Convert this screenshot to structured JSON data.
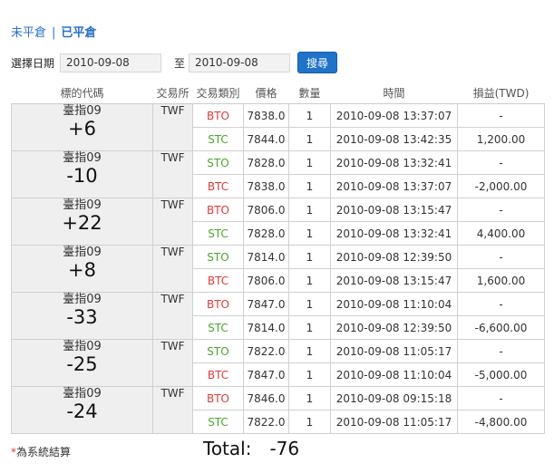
{
  "tabs": {
    "open_label": "未平倉",
    "closed_label": "已平倉"
  },
  "datebar": {
    "label": "選擇日期",
    "from": "2010-09-08",
    "to_label": "至",
    "to": "2010-09-08",
    "search_label": "搜尋"
  },
  "columns": [
    "標的代碼",
    "交易所",
    "交易類別",
    "價格",
    "數量",
    "時間",
    "損益(TWD)"
  ],
  "groups": [
    {
      "symbol": "臺指09",
      "points": "+6",
      "exchange": "TWF",
      "rows": [
        {
          "type": "BTO",
          "price": "7838.0",
          "qty": "1",
          "time": "2010-09-08 13:37:07",
          "pl": "-"
        },
        {
          "type": "STC",
          "price": "7844.0",
          "qty": "1",
          "time": "2010-09-08 13:42:35",
          "pl": "1,200.00"
        }
      ]
    },
    {
      "symbol": "臺指09",
      "points": "-10",
      "exchange": "TWF",
      "rows": [
        {
          "type": "STO",
          "price": "7828.0",
          "qty": "1",
          "time": "2010-09-08 13:32:41",
          "pl": "-"
        },
        {
          "type": "BTC",
          "price": "7838.0",
          "qty": "1",
          "time": "2010-09-08 13:37:07",
          "pl": "-2,000.00"
        }
      ]
    },
    {
      "symbol": "臺指09",
      "points": "+22",
      "exchange": "TWF",
      "rows": [
        {
          "type": "BTO",
          "price": "7806.0",
          "qty": "1",
          "time": "2010-09-08 13:15:47",
          "pl": "-"
        },
        {
          "type": "STC",
          "price": "7828.0",
          "qty": "1",
          "time": "2010-09-08 13:32:41",
          "pl": "4,400.00"
        }
      ]
    },
    {
      "symbol": "臺指09",
      "points": "+8",
      "exchange": "TWF",
      "rows": [
        {
          "type": "STO",
          "price": "7814.0",
          "qty": "1",
          "time": "2010-09-08 12:39:50",
          "pl": "-"
        },
        {
          "type": "BTC",
          "price": "7806.0",
          "qty": "1",
          "time": "2010-09-08 13:15:47",
          "pl": "1,600.00"
        }
      ]
    },
    {
      "symbol": "臺指09",
      "points": "-33",
      "exchange": "TWF",
      "rows": [
        {
          "type": "BTO",
          "price": "7847.0",
          "qty": "1",
          "time": "2010-09-08 11:10:04",
          "pl": "-"
        },
        {
          "type": "STC",
          "price": "7814.0",
          "qty": "1",
          "time": "2010-09-08 12:39:50",
          "pl": "-6,600.00"
        }
      ]
    },
    {
      "symbol": "臺指09",
      "points": "-25",
      "exchange": "TWF",
      "rows": [
        {
          "type": "STO",
          "price": "7822.0",
          "qty": "1",
          "time": "2010-09-08 11:05:17",
          "pl": "-"
        },
        {
          "type": "BTC",
          "price": "7847.0",
          "qty": "1",
          "time": "2010-09-08 11:10:04",
          "pl": "-5,000.00"
        }
      ]
    },
    {
      "symbol": "臺指09",
      "points": "-24",
      "exchange": "TWF",
      "rows": [
        {
          "type": "BTO",
          "price": "7846.0",
          "qty": "1",
          "time": "2010-09-08 09:15:18",
          "pl": "-"
        },
        {
          "type": "STC",
          "price": "7822.0",
          "qty": "1",
          "time": "2010-09-08 11:05:17",
          "pl": "-4,800.00"
        }
      ]
    }
  ],
  "footer": {
    "star": "*",
    "note": "為系統結算"
  },
  "total": {
    "label": "Total:",
    "value": "-76"
  },
  "colors": {
    "red": "#e03a3a",
    "green": "#4aa62a",
    "link": "#2a6fc9",
    "button": "#1f73c8"
  }
}
